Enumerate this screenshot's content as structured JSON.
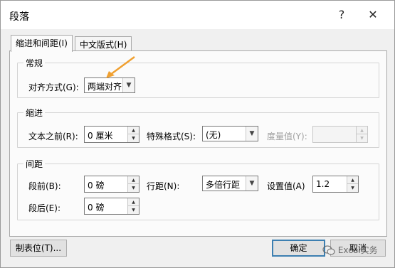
{
  "window": {
    "title": "段落",
    "help_label": "?",
    "close_label": "✕"
  },
  "tabs": [
    {
      "label": "缩进和间距(I)",
      "active": true
    },
    {
      "label": "中文版式(H)",
      "active": false
    }
  ],
  "general": {
    "title": "常规",
    "alignment_label": "对齐方式(G):",
    "alignment_value": "两端对齐"
  },
  "indent": {
    "title": "缩进",
    "before_label": "文本之前(R):",
    "before_value": "0 厘米",
    "special_label": "特殊格式(S):",
    "special_value": "(无)",
    "measure_label": "度量值(Y):",
    "measure_value": ""
  },
  "spacing": {
    "title": "间距",
    "before_label": "段前(B):",
    "before_value": "0 磅",
    "after_label": "段后(E):",
    "after_value": "0 磅",
    "line_label": "行距(N):",
    "line_value": "多倍行距",
    "at_label": "设置值(A)",
    "at_value": "1.2"
  },
  "buttons": {
    "tabs_label": "制表位(T)...",
    "ok_label": "确定",
    "cancel_label": "取消"
  },
  "watermark": {
    "text": "Excel实务",
    "icon": "wechat-icon"
  },
  "annotation": {
    "icon": "arrow-icon",
    "color": "#f0a030"
  },
  "colors": {
    "default_button_border": "#3c7fb1",
    "annotation_arrow": "#f0a030"
  }
}
